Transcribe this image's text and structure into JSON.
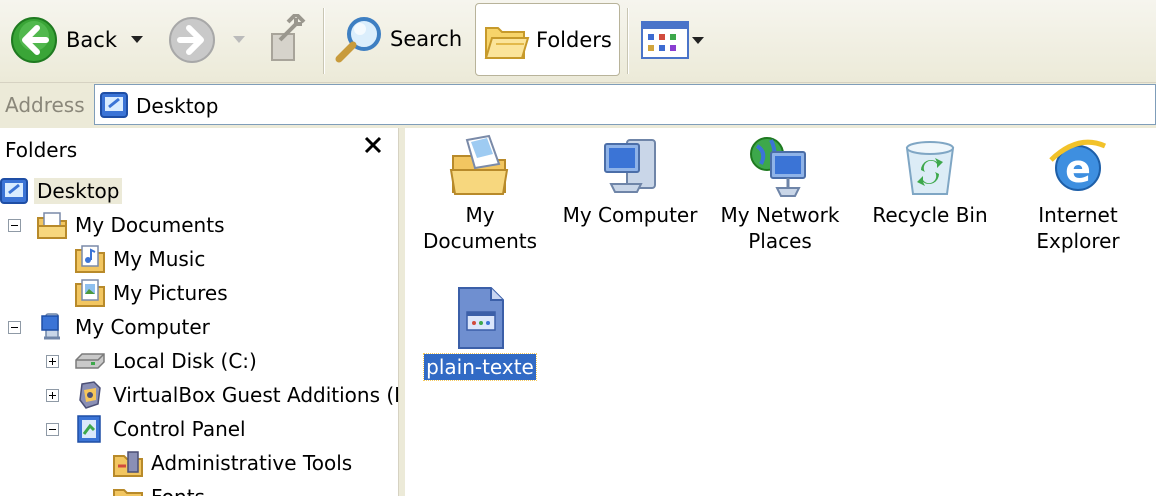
{
  "toolbar": {
    "back_label": "Back",
    "search_label": "Search",
    "folders_label": "Folders"
  },
  "address": {
    "label": "Address",
    "value": "Desktop"
  },
  "folder_pane": {
    "title": "Folders",
    "close_glyph": "✕",
    "tree": [
      {
        "label": "Desktop",
        "icon": "desktop-icon"
      },
      {
        "label": "My Documents",
        "icon": "my-documents-icon"
      },
      {
        "label": "My Music",
        "icon": "my-music-icon"
      },
      {
        "label": "My Pictures",
        "icon": "my-pictures-icon"
      },
      {
        "label": "My Computer",
        "icon": "my-computer-icon"
      },
      {
        "label": "Local Disk (C:)",
        "icon": "local-disk-icon"
      },
      {
        "label": "VirtualBox Guest Additions (D",
        "icon": "cd-drive-icon"
      },
      {
        "label": "Control Panel",
        "icon": "control-panel-icon"
      },
      {
        "label": "Administrative Tools",
        "icon": "administrative-tools-icon"
      },
      {
        "label": "Fonts",
        "icon": "fonts-folder-icon"
      }
    ]
  },
  "desktop_items": [
    {
      "label": "My Documents",
      "icon": "my-documents-icon"
    },
    {
      "label": "My Computer",
      "icon": "my-computer-icon"
    },
    {
      "label": "My Network Places",
      "icon": "network-places-icon"
    },
    {
      "label": "Recycle Bin",
      "icon": "recycle-bin-icon"
    },
    {
      "label": "Internet Explorer",
      "icon": "internet-explorer-icon"
    },
    {
      "label": "plain-texte",
      "icon": "text-file-icon"
    }
  ],
  "colors": {
    "selection": "#316ac5",
    "toolbar_bg": "#ecead8",
    "back_green": "#3aa537"
  }
}
